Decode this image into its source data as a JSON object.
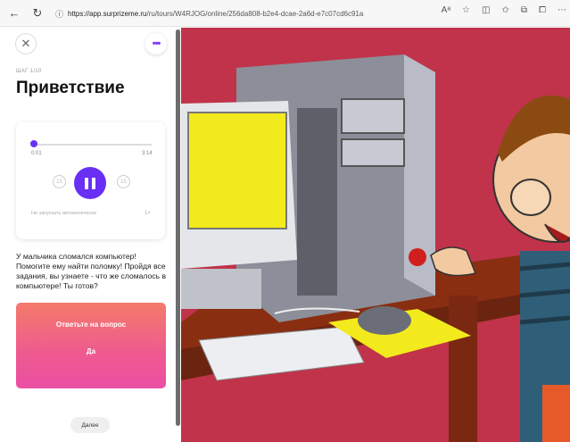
{
  "browser": {
    "url_domain": "https://app.surprizeme.ru",
    "url_path": "/ru/tours/W4RJOG/online/256da808-b2e4-dcae-2a6d-e7c07cd6c91a",
    "reader_icon": "Aᵃ"
  },
  "panel": {
    "step": "ШАГ 1/10",
    "title": "Приветствие",
    "more_label": "•••",
    "close_label": "✕"
  },
  "player": {
    "time_current": "0:01",
    "time_total": "3:14",
    "rewind_label": "15",
    "forward_label": "15",
    "autoplay_label": "Не запускать автоматически",
    "speed_label": "1×",
    "progress": 0.01
  },
  "description": "У мальчика сломался компьютер! Помогите ему найти поломку! Пройдя все задания,  вы узнаете - что же сломалось в компьютере! Ты готов?",
  "question": {
    "title": "Ответьте на вопрос",
    "answer": "Да"
  },
  "next_label": "Далее",
  "colors": {
    "accent": "#6a2ff5",
    "cta_top": "#f47b6b",
    "cta_bottom": "#ea4fa4",
    "scene_bg": "#c0334a"
  }
}
